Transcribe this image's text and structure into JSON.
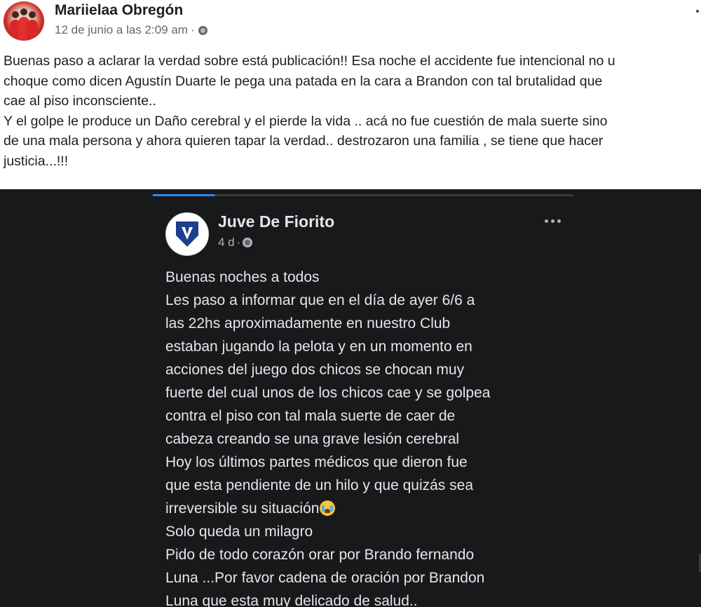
{
  "outer_post": {
    "author": "Mariielaa Obregón",
    "timestamp": "12 de junio a las 2:09 am",
    "separator": "·",
    "privacy_icon": "globe-icon",
    "text_lines": [
      "Buenas paso a aclarar la verdad sobre está publicación!! Esa noche el accidente fue intencional no u",
      "choque como dicen Agustín Duarte le pega una patada en la cara a Brandon con tal brutalidad que",
      "cae al piso inconsciente..",
      "Y el golpe le produce un Daño cerebral y el pierde la vida ..  acá no fue cuestión de mala suerte sino",
      "de una mala persona y ahora quieren tapar la verdad.. destrozaron una familia , se tiene que hacer",
      "justicia...!!!"
    ]
  },
  "shared_post": {
    "author": "Juve De Fiorito",
    "timestamp": "4 d",
    "separator": "·",
    "privacy_icon": "globe-icon",
    "more_icon": "more-options-icon",
    "text_lines": [
      "Buenas noches a todos",
      "Les paso a informar que en el día de ayer 6/6 a",
      "las 22hs aproximadamente en nuestro Club",
      "estaban jugando  la pelota y en un momento en",
      "acciones del juego dos chicos se chocan muy",
      "fuerte del cual unos de los chicos cae y se golpea",
      "contra el piso con tal mala suerte de caer de",
      "cabeza creando se una grave lesión cerebral",
      "Hoy los últimos  partes médicos que dieron fue",
      "que esta pendiente de un hilo y que quizás  sea",
      "irreversible su situación",
      "Solo queda un milagro",
      "Pido de todo corazón orar por Brando fernando",
      "Luna ...Por favor  cadena de oración por Brandon",
      "Luna que esta muy delicado de salud.."
    ],
    "emoji_icon": "crying-face-emoji"
  }
}
